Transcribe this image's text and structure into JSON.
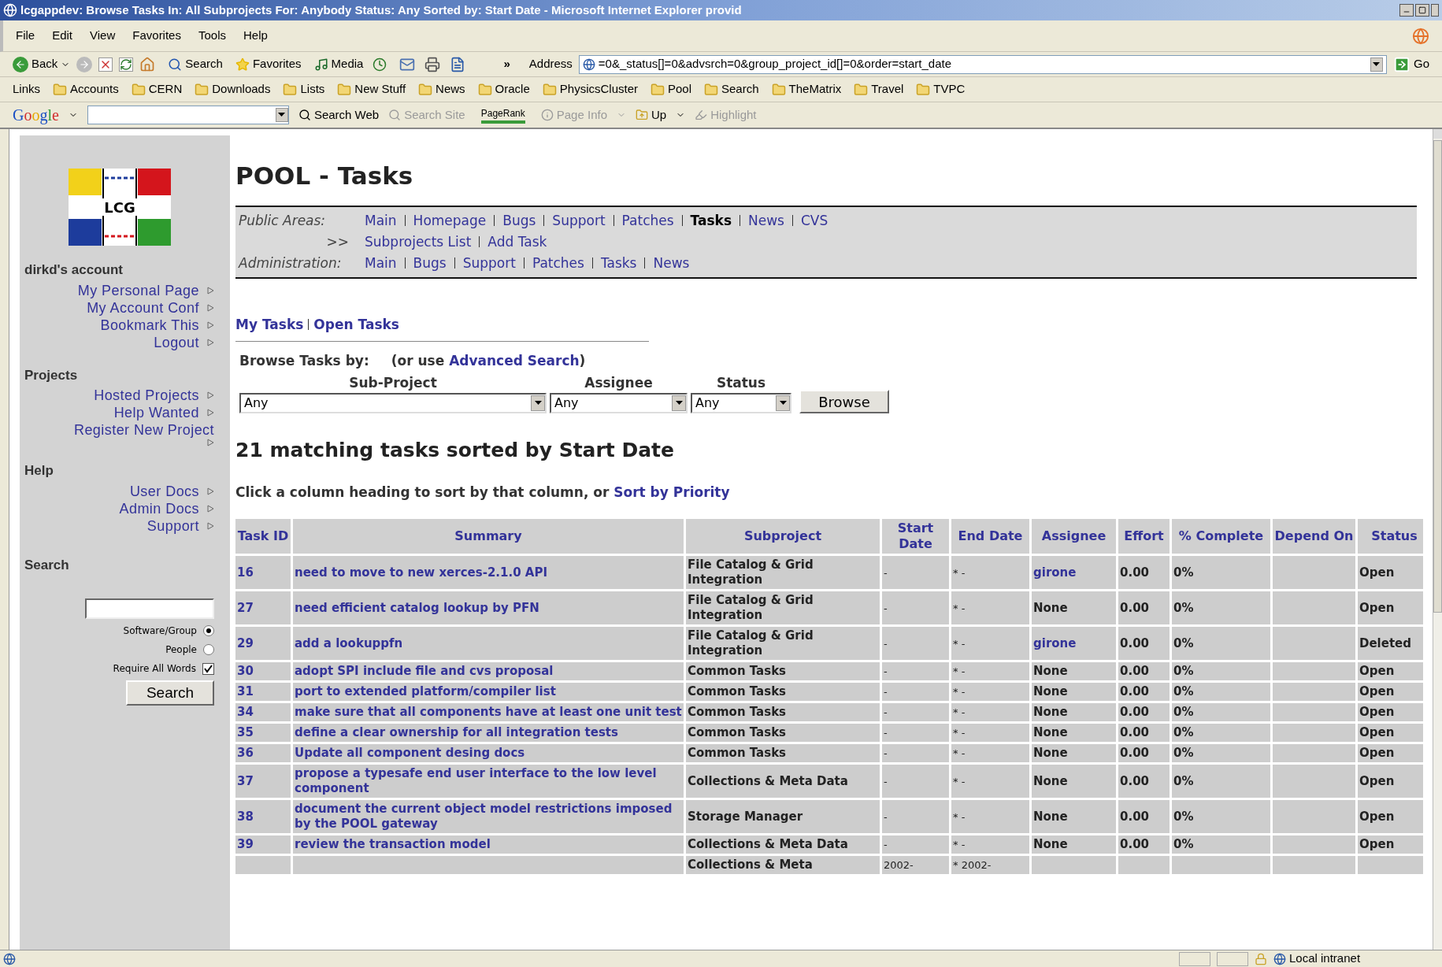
{
  "window": {
    "title": "lcgappdev: Browse Tasks In: All Subprojects For: Anybody Status: Any Sorted by: Start Date - Microsoft Internet Explorer provid"
  },
  "menu": [
    "File",
    "Edit",
    "View",
    "Favorites",
    "Tools",
    "Help"
  ],
  "toolbar": {
    "back": "Back",
    "search": "Search",
    "favorites": "Favorites",
    "media": "Media",
    "chevron": "»",
    "address_label": "Address",
    "address": "=0&_status[]=0&advsrch=0&group_project_id[]=0&order=start_date",
    "go": "Go"
  },
  "links_bar": {
    "label": "Links",
    "items": [
      "Accounts",
      "CERN",
      "Downloads",
      "Lists",
      "New Stuff",
      "News",
      "Oracle",
      "PhysicsCluster",
      "Pool",
      "Search",
      "TheMatrix",
      "Travel",
      "TVPC"
    ]
  },
  "google_bar": {
    "logo": "Google",
    "items": [
      {
        "label": "Search Web",
        "kind": "search",
        "disabled": false
      },
      {
        "label": "Search Site",
        "kind": "site",
        "disabled": true
      },
      {
        "label": "PageRank",
        "kind": "rank",
        "disabled": false
      },
      {
        "label": "Page Info",
        "kind": "info",
        "disabled": true
      },
      {
        "label": "Up",
        "kind": "up",
        "disabled": false
      },
      {
        "label": "Highlight",
        "kind": "highlight",
        "disabled": true
      }
    ]
  },
  "sidebar": {
    "logo": "LCG",
    "sections": [
      {
        "title": "dirkd's account",
        "links": [
          "My Personal Page",
          "My Account Conf",
          "Bookmark This",
          "Logout"
        ]
      },
      {
        "title": "Projects",
        "links": [
          "Hosted Projects",
          "Help Wanted",
          "Register New Project"
        ]
      },
      {
        "title": "Help",
        "links": [
          "User Docs",
          "Admin Docs",
          "Support"
        ]
      }
    ],
    "search": {
      "title": "Search",
      "options": [
        {
          "label": "Software/Group",
          "kind": "radio",
          "checked": true
        },
        {
          "label": "People",
          "kind": "radio",
          "checked": false
        },
        {
          "label": "Require All Words",
          "kind": "checkbox",
          "checked": true
        }
      ],
      "button": "Search"
    }
  },
  "main": {
    "title": "POOL - Tasks",
    "nav": [
      {
        "label": "Public Areas:",
        "kind": "area",
        "links": [
          {
            "text": "Main",
            "current": false
          },
          {
            "text": "Homepage",
            "current": false
          },
          {
            "text": "Bugs",
            "current": false
          },
          {
            "text": "Support",
            "current": false
          },
          {
            "text": "Patches",
            "current": false
          },
          {
            "text": "Tasks",
            "current": true
          },
          {
            "text": "News",
            "current": false
          },
          {
            "text": "CVS",
            "current": false
          }
        ]
      },
      {
        "label": ">>",
        "kind": "sub",
        "links": [
          {
            "text": "Subprojects List",
            "current": false
          },
          {
            "text": "Add Task",
            "current": false
          }
        ]
      },
      {
        "label": "Administration:",
        "kind": "area",
        "links": [
          {
            "text": "Main",
            "current": false
          },
          {
            "text": "Bugs",
            "current": false
          },
          {
            "text": "Support",
            "current": false
          },
          {
            "text": "Patches",
            "current": false
          },
          {
            "text": "Tasks",
            "current": false
          },
          {
            "text": "News",
            "current": false
          }
        ]
      }
    ],
    "quick_links": [
      "My Tasks",
      "Open Tasks"
    ],
    "browse": {
      "label": "Browse Tasks by:",
      "hint_before": "(or use",
      "hint_link": "Advanced Search",
      "hint_after": ")",
      "filters": [
        {
          "label": "Sub-Project",
          "value": "Any"
        },
        {
          "label": "Assignee",
          "value": "Any"
        },
        {
          "label": "Status",
          "value": "Any"
        }
      ],
      "button": "Browse"
    },
    "result_heading": "21 matching tasks sorted by Start Date",
    "sort_hint": {
      "text": "Click a column heading to sort by that column, or",
      "link": "Sort by Priority"
    },
    "table": {
      "columns": [
        "Task ID",
        "Summary",
        "Subproject",
        "Start Date",
        "End Date",
        "Assignee",
        "Effort",
        "% Complete",
        "Depend On",
        "Status"
      ],
      "rows": [
        {
          "id": "16",
          "summary": "need to move to new xerces-2.1.0 API",
          "subproject": "File Catalog & Grid Integration",
          "start": "-",
          "end": "* -",
          "assignee": "girone",
          "assignee_link": true,
          "effort": "0.00",
          "complete": "0%",
          "status": "Open"
        },
        {
          "id": "27",
          "summary": "need efficient catalog lookup by PFN",
          "subproject": "File Catalog & Grid Integration",
          "start": "-",
          "end": "* -",
          "assignee": "None",
          "assignee_link": false,
          "effort": "0.00",
          "complete": "0%",
          "status": "Open"
        },
        {
          "id": "29",
          "summary": "add a lookuppfn",
          "subproject": "File Catalog & Grid Integration",
          "start": "-",
          "end": "* -",
          "assignee": "girone",
          "assignee_link": true,
          "effort": "0.00",
          "complete": "0%",
          "status": "Deleted"
        },
        {
          "id": "30",
          "summary": "adopt SPI include file and cvs proposal",
          "subproject": "Common Tasks",
          "start": "-",
          "end": "* -",
          "assignee": "None",
          "assignee_link": false,
          "effort": "0.00",
          "complete": "0%",
          "status": "Open"
        },
        {
          "id": "31",
          "summary": "port to extended platform/compiler list",
          "subproject": "Common Tasks",
          "start": "-",
          "end": "* -",
          "assignee": "None",
          "assignee_link": false,
          "effort": "0.00",
          "complete": "0%",
          "status": "Open"
        },
        {
          "id": "34",
          "summary": "make sure that all components have at least one unit test",
          "subproject": "Common Tasks",
          "start": "-",
          "end": "* -",
          "assignee": "None",
          "assignee_link": false,
          "effort": "0.00",
          "complete": "0%",
          "status": "Open"
        },
        {
          "id": "35",
          "summary": "define a clear ownership for all integration tests",
          "subproject": "Common Tasks",
          "start": "-",
          "end": "* -",
          "assignee": "None",
          "assignee_link": false,
          "effort": "0.00",
          "complete": "0%",
          "status": "Open"
        },
        {
          "id": "36",
          "summary": "Update all component desing docs",
          "subproject": "Common Tasks",
          "start": "-",
          "end": "* -",
          "assignee": "None",
          "assignee_link": false,
          "effort": "0.00",
          "complete": "0%",
          "status": "Open"
        },
        {
          "id": "37",
          "summary": "propose a typesafe end user interface to the low level component",
          "subproject": "Collections & Meta Data",
          "start": "-",
          "end": "* -",
          "assignee": "None",
          "assignee_link": false,
          "effort": "0.00",
          "complete": "0%",
          "status": "Open"
        },
        {
          "id": "38",
          "summary": "document the current object model restrictions imposed by the POOL gateway",
          "subproject": "Storage Manager",
          "start": "-",
          "end": "* -",
          "assignee": "None",
          "assignee_link": false,
          "effort": "0.00",
          "complete": "0%",
          "status": "Open"
        },
        {
          "id": "39",
          "summary": "review the transaction model",
          "subproject": "Collections & Meta Data",
          "start": "-",
          "end": "* -",
          "assignee": "None",
          "assignee_link": false,
          "effort": "0.00",
          "complete": "0%",
          "status": "Open"
        },
        {
          "subproject": "Collections & Meta",
          "start": "2002-",
          "end": "* 2002-"
        }
      ]
    }
  },
  "status_bar": {
    "zone": "Local intranet"
  }
}
